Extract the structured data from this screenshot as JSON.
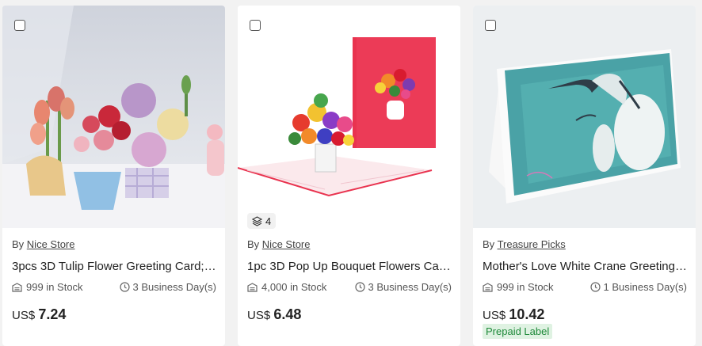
{
  "products": [
    {
      "image_alt": "3D tulip flower greeting card photo",
      "by_prefix": "By",
      "store": "Nice Store",
      "title": "3pcs 3D Tulip Flower Greeting Card; ...",
      "stock": "999 in Stock",
      "shipping": "3 Business Day(s)",
      "currency": "US$",
      "price": "7.24"
    },
    {
      "image_alt": "3D pop up bouquet card photo",
      "by_prefix": "By",
      "store": "Nice Store",
      "title": "1pc 3D Pop Up Bouquet Flowers Card...",
      "stock": "4,000 in Stock",
      "shipping": "3 Business Day(s)",
      "currency": "US$",
      "price": "6.48",
      "variant_count": "4"
    },
    {
      "image_alt": "White crane greeting card photo",
      "by_prefix": "By",
      "store": "Treasure Picks",
      "title": "Mother's Love White Crane Greeting ...",
      "stock": "999 in Stock",
      "shipping": "1 Business Day(s)",
      "currency": "US$",
      "price": "10.42",
      "badge": "Prepaid Label"
    }
  ],
  "colors": {
    "card_bg": "#ffffff",
    "page_bg": "#f2f2f2",
    "prepaid_bg": "#dff2e2",
    "prepaid_text": "#1f8a3a"
  },
  "icons": [
    "warehouse-icon",
    "clock-icon",
    "layers-icon",
    "checkbox-icon"
  ]
}
